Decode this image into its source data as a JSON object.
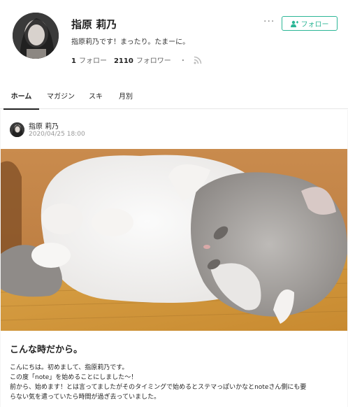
{
  "profile": {
    "name": "指原 莉乃",
    "bio": "指原莉乃です！まったり。たまーに。",
    "following_count": "1",
    "following_label": "フォロー",
    "follower_count": "2110",
    "follower_label": "フォロワー",
    "separator": "・",
    "more_label": "···",
    "follow_button_label": "フォロー",
    "accent_color": "#2cb696"
  },
  "tabs": [
    {
      "label": "ホーム",
      "active": true
    },
    {
      "label": "マガジン",
      "active": false
    },
    {
      "label": "スキ",
      "active": false
    },
    {
      "label": "月別",
      "active": false
    }
  ],
  "post": {
    "author": "指原 莉乃",
    "date": "2020/04/25 18:00",
    "image": "cat-photo",
    "title": "こんな時だから。",
    "paragraphs": [
      "こんにちは。初めまして、指原莉乃です。",
      "この度「note」を始めることにしました〜！",
      "前から、始めます！とは言ってましたがそのタイミングで始めるとステマっぽいかなとnoteさん側にも要",
      "らない気を遣っていたら時間が過ぎ去っていました。"
    ]
  },
  "icons": {
    "follow": "add-user-icon",
    "rss": "rss-icon",
    "more": "more-icon"
  }
}
